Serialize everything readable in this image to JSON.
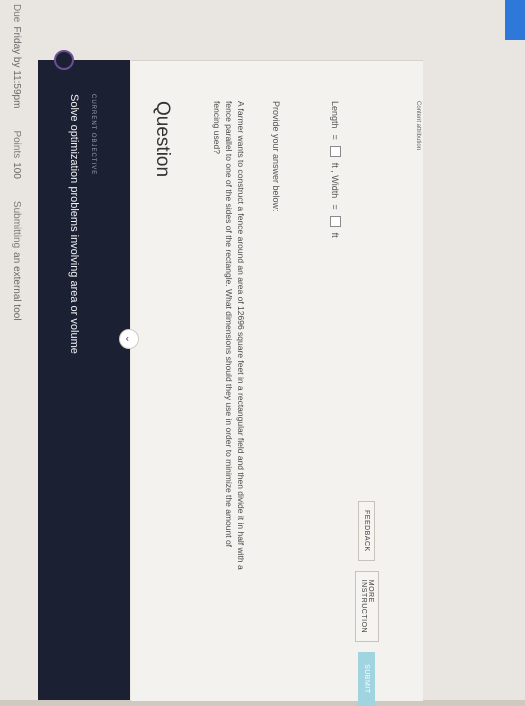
{
  "topbar": {
    "due_label": "Due",
    "due_value": "Friday by 11:59pm",
    "points_label": "Points",
    "points_value": "100",
    "submitting_label": "Submitting",
    "submitting_value": "an external tool"
  },
  "objective": {
    "label": "CURRENT OBJECTIVE",
    "title": "Solve optimization problems involving area or volume"
  },
  "question": {
    "heading": "Question",
    "text": "A farmer wants to construct a fence around an area of 12696 square feet in a rectangular field and then divide it in half with a fence parallel to one of the sides of the rectangle. What dimensions should they use in order to minimize the amount of fencing used?",
    "prompt": "Provide your answer below:",
    "length_label": "Length",
    "width_label": "ft , Width",
    "equals": "=",
    "unit": "ft"
  },
  "actions": {
    "feedback": "FEEDBACK",
    "more_instruction": "MORE INSTRUCTION",
    "submit": "SUBMIT"
  },
  "footer": {
    "attribution": "Content attribution"
  },
  "colors": {
    "banner": "#1c2033",
    "accent": "#6b4f97",
    "submit": "#9fd4e0",
    "corner": "#2d78d8"
  }
}
